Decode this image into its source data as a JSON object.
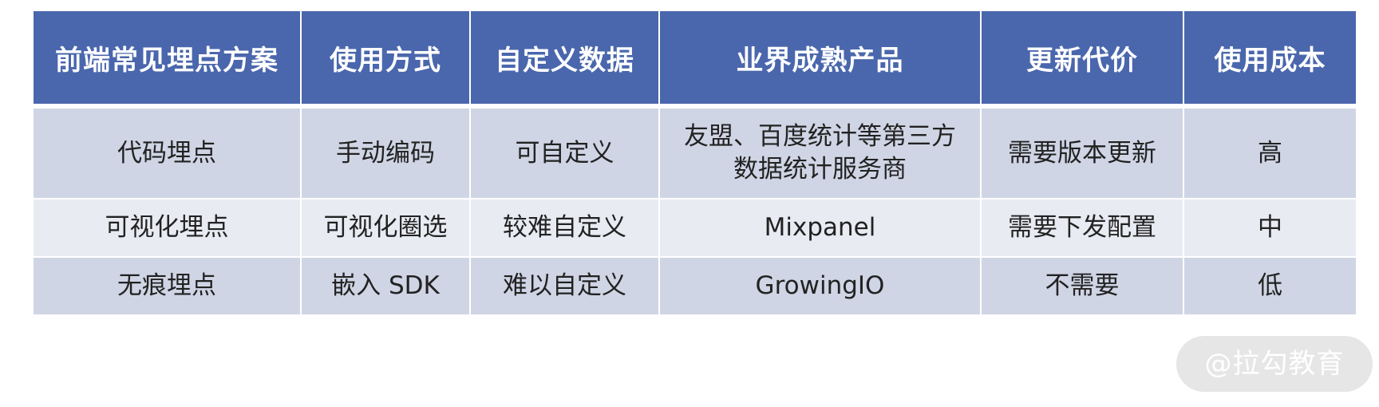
{
  "table": {
    "headers": [
      "前端常见埋点方案",
      "使用方式",
      "自定义数据",
      "业界成熟产品",
      "更新代价",
      "使用成本"
    ],
    "rows": [
      {
        "scheme": "代码埋点",
        "usage": "手动编码",
        "custom_data": "可自定义",
        "products_line1": "友盟、百度统计等第三方",
        "products_line2": "数据统计服务商",
        "update_cost": "需要版本更新",
        "usage_cost": "高"
      },
      {
        "scheme": "可视化埋点",
        "usage": "可视化圈选",
        "custom_data": "较难自定义",
        "products_line1": "Mixpanel",
        "update_cost": "需要下发配置",
        "usage_cost": "中"
      },
      {
        "scheme": "无痕埋点",
        "usage": "嵌入 SDK",
        "custom_data": "难以自定义",
        "products_line1": "GrowingIO",
        "update_cost": "不需要",
        "usage_cost": "低"
      }
    ]
  },
  "watermark": "@拉勾教育",
  "colors": {
    "header_bg": "#4a67ad",
    "row_odd_bg": "#d0d5e5",
    "row_even_bg": "#e9ebf3"
  }
}
